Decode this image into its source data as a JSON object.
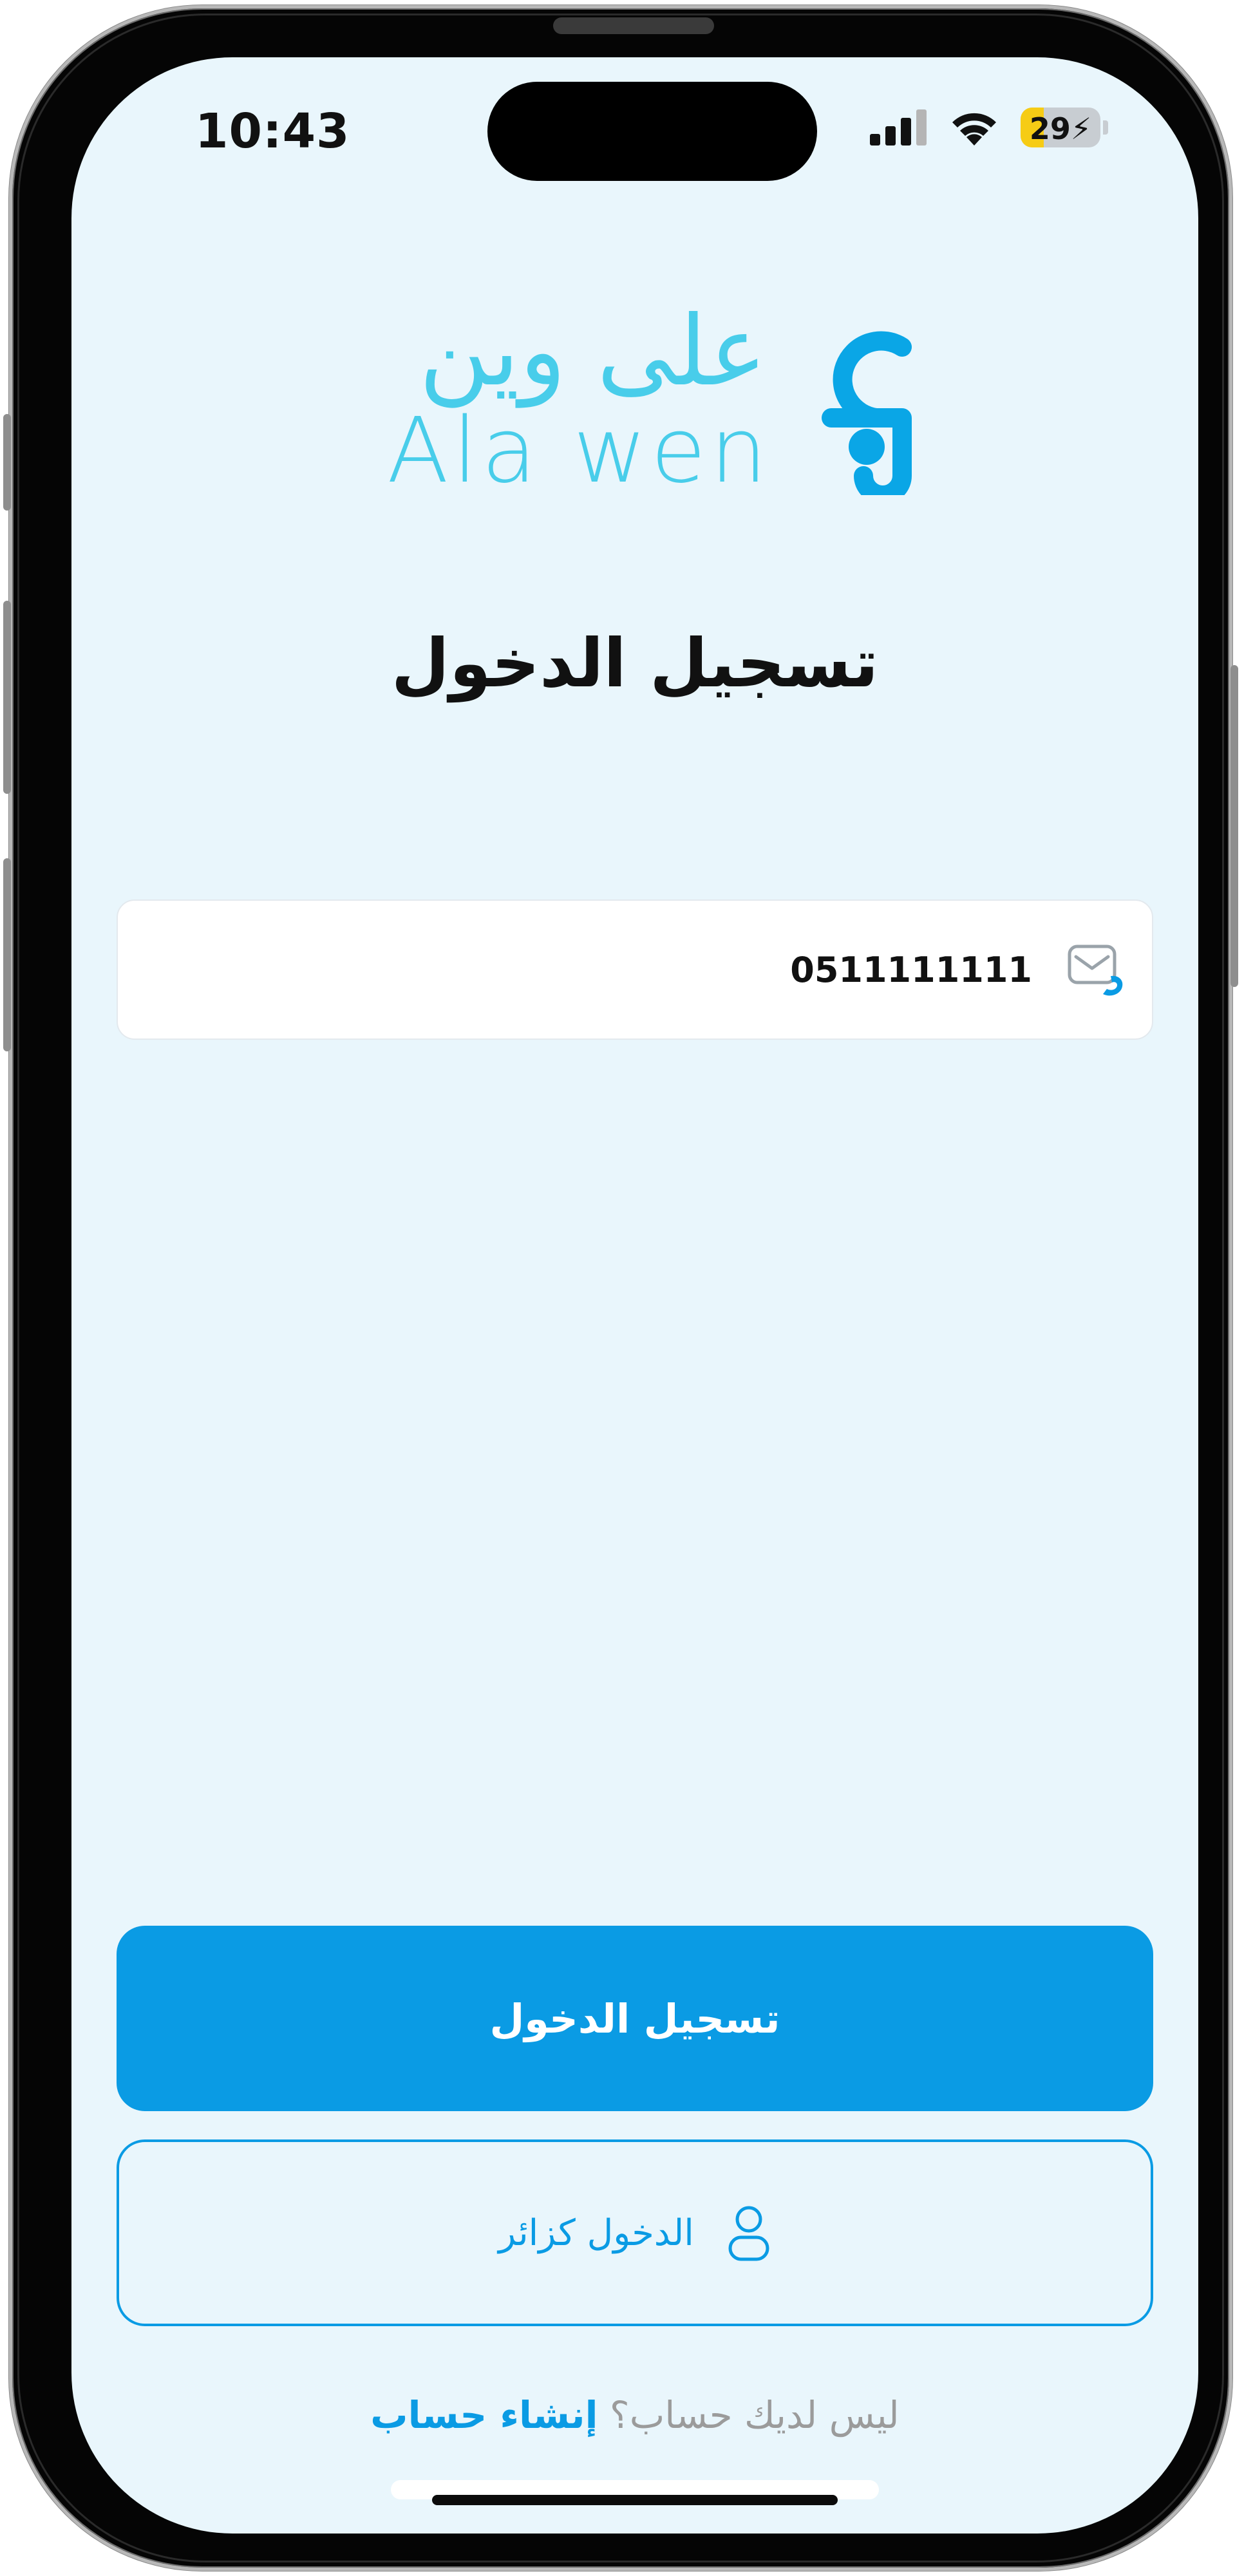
{
  "status_bar": {
    "time": "10:43",
    "battery_level": "29",
    "battery_fraction": 0.29,
    "signal_icon": "cellular-signal-icon",
    "wifi_icon": "wifi-icon",
    "battery_icon": "battery-charging-icon"
  },
  "logo": {
    "arabic_name": "على وين",
    "latin_name": "Ala wen",
    "mark_icon": "alawen-logo-mark-icon"
  },
  "login": {
    "title": "تسجيل الدخول",
    "phone_value": "0511111111",
    "phone_icon": "phone-envelope-icon"
  },
  "buttons": {
    "login_label": "تسجيل الدخول",
    "guest_label": "الدخول كزائر",
    "guest_icon": "user-icon"
  },
  "signup": {
    "prompt": "ليس لديك حساب؟",
    "link": "إنشاء حساب"
  },
  "colors": {
    "accent": "#0a9be4",
    "logo_light": "#48cdea",
    "background": "#e9f6fc",
    "battery": "#f6cc15"
  }
}
